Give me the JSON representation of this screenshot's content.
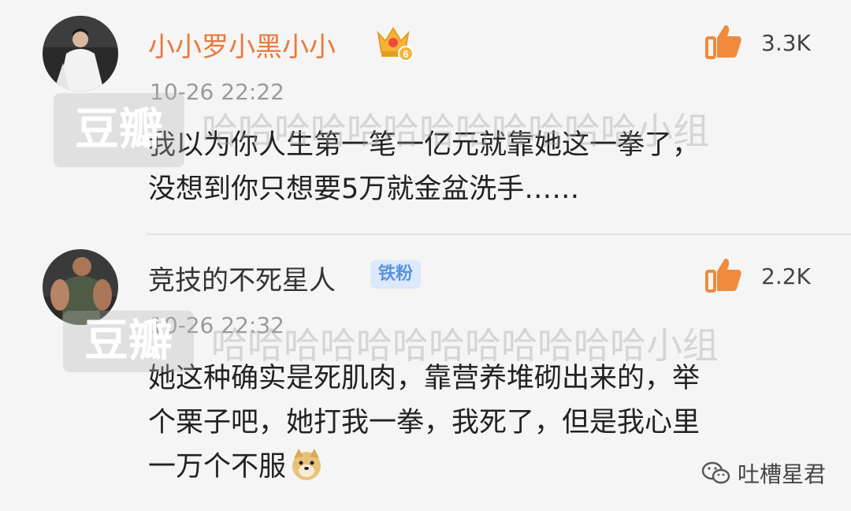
{
  "comments": [
    {
      "username": "小小罗小黑小小",
      "badge": "6",
      "likes": "3.3K",
      "time": "10-26 22:22",
      "lines": [
        "我以为你人生第一笔一亿元就靠她这一拳了，",
        "没想到你只想要5万就金盆洗手……"
      ]
    },
    {
      "username": "竞技的不死星人",
      "badge": "铁粉",
      "likes": "2.2K",
      "time": "10-26 22:32",
      "lines": [
        "她这种确实是死肌肉，靠营养堆砌出来的，举",
        "个栗子吧，她打我一拳，我死了，但是我心里",
        "一万个不服"
      ]
    }
  ],
  "watermark": {
    "logo": "豆瓣",
    "group": "哈哈哈哈哈哈哈哈哈哈哈哈小组"
  },
  "wechat_source": "吐槽星君",
  "colors": {
    "vip_name": "#e8793b",
    "like_icon": "#f08a3c",
    "fan_badge_bg": "#dbe9fb",
    "fan_badge_text": "#5a93e0"
  }
}
